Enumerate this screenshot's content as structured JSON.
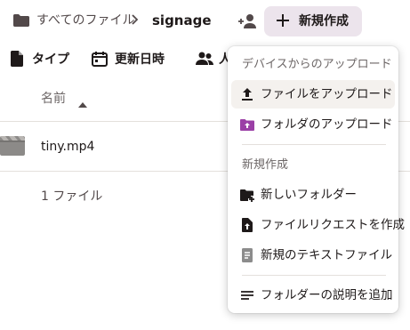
{
  "breadcrumb": {
    "root": "すべてのファイル",
    "current": "signage"
  },
  "header": {
    "create_label": "新規作成"
  },
  "toolbar": {
    "items": [
      {
        "label": "タイプ",
        "icon": "file-icon"
      },
      {
        "label": "更新日時",
        "icon": "calendar-icon"
      },
      {
        "label": "人",
        "icon": "people-icon"
      }
    ]
  },
  "list": {
    "column_name": "名前",
    "files": [
      {
        "name": "tiny.mp4",
        "icon": "video-file-icon"
      }
    ],
    "file_count": "1 ファイル"
  },
  "menu": {
    "upload_section": "デバイスからのアップロード",
    "upload_items": [
      {
        "label": "ファイルをアップロード",
        "icon": "upload-icon"
      },
      {
        "label": "フォルダのアップロード",
        "icon": "folder-upload-icon"
      }
    ],
    "create_section": "新規作成",
    "create_items": [
      {
        "label": "新しいフォルダー",
        "icon": "new-folder-icon"
      },
      {
        "label": "ファイルリクエストを作成",
        "icon": "file-request-icon"
      },
      {
        "label": "新規のテキストファイル",
        "icon": "text-file-icon"
      }
    ],
    "extra_items": [
      {
        "label": "フォルダーの説明を追加",
        "icon": "description-icon"
      }
    ]
  },
  "colors": {
    "create_button_bg": "#ece4ec",
    "folder_upload_icon": "#9b3fa6",
    "text_file_icon": "#8c8c8c"
  }
}
